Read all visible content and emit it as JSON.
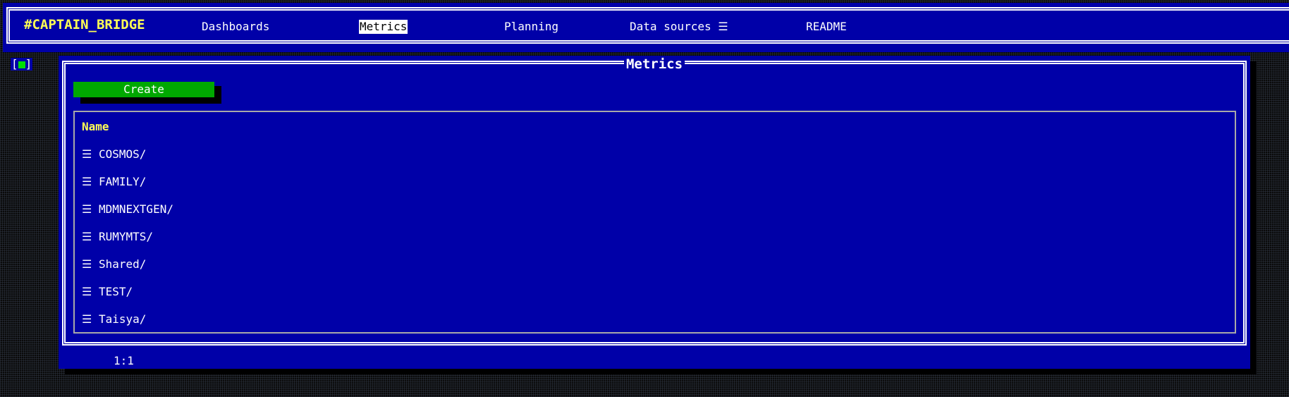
{
  "app": {
    "brand": "#CAPTAIN_BRIDGE"
  },
  "nav": {
    "items": [
      {
        "label": "Dashboards"
      },
      {
        "label": "Metrics"
      },
      {
        "label": "Planning"
      },
      {
        "label": "Data sources ☰"
      },
      {
        "label": "README"
      }
    ],
    "active": "Metrics"
  },
  "window": {
    "title": "Metrics",
    "close_box_left": "[",
    "close_box_right": "]"
  },
  "toolbar": {
    "create_label": "Create"
  },
  "list": {
    "header": "Name",
    "item_icon": "☰",
    "items": [
      {
        "name": "COSMOS/"
      },
      {
        "name": "FAMILY/"
      },
      {
        "name": "MDMNEXTGEN/"
      },
      {
        "name": "RUMYMTS/"
      },
      {
        "name": "Shared/"
      },
      {
        "name": "TEST/"
      },
      {
        "name": "Taisya/"
      }
    ]
  },
  "status": {
    "cursor_position": "1:1"
  },
  "colors": {
    "background": "#0000a8",
    "accent_green": "#00a800",
    "highlight_yellow": "#ffff55",
    "text": "#ffffff"
  }
}
